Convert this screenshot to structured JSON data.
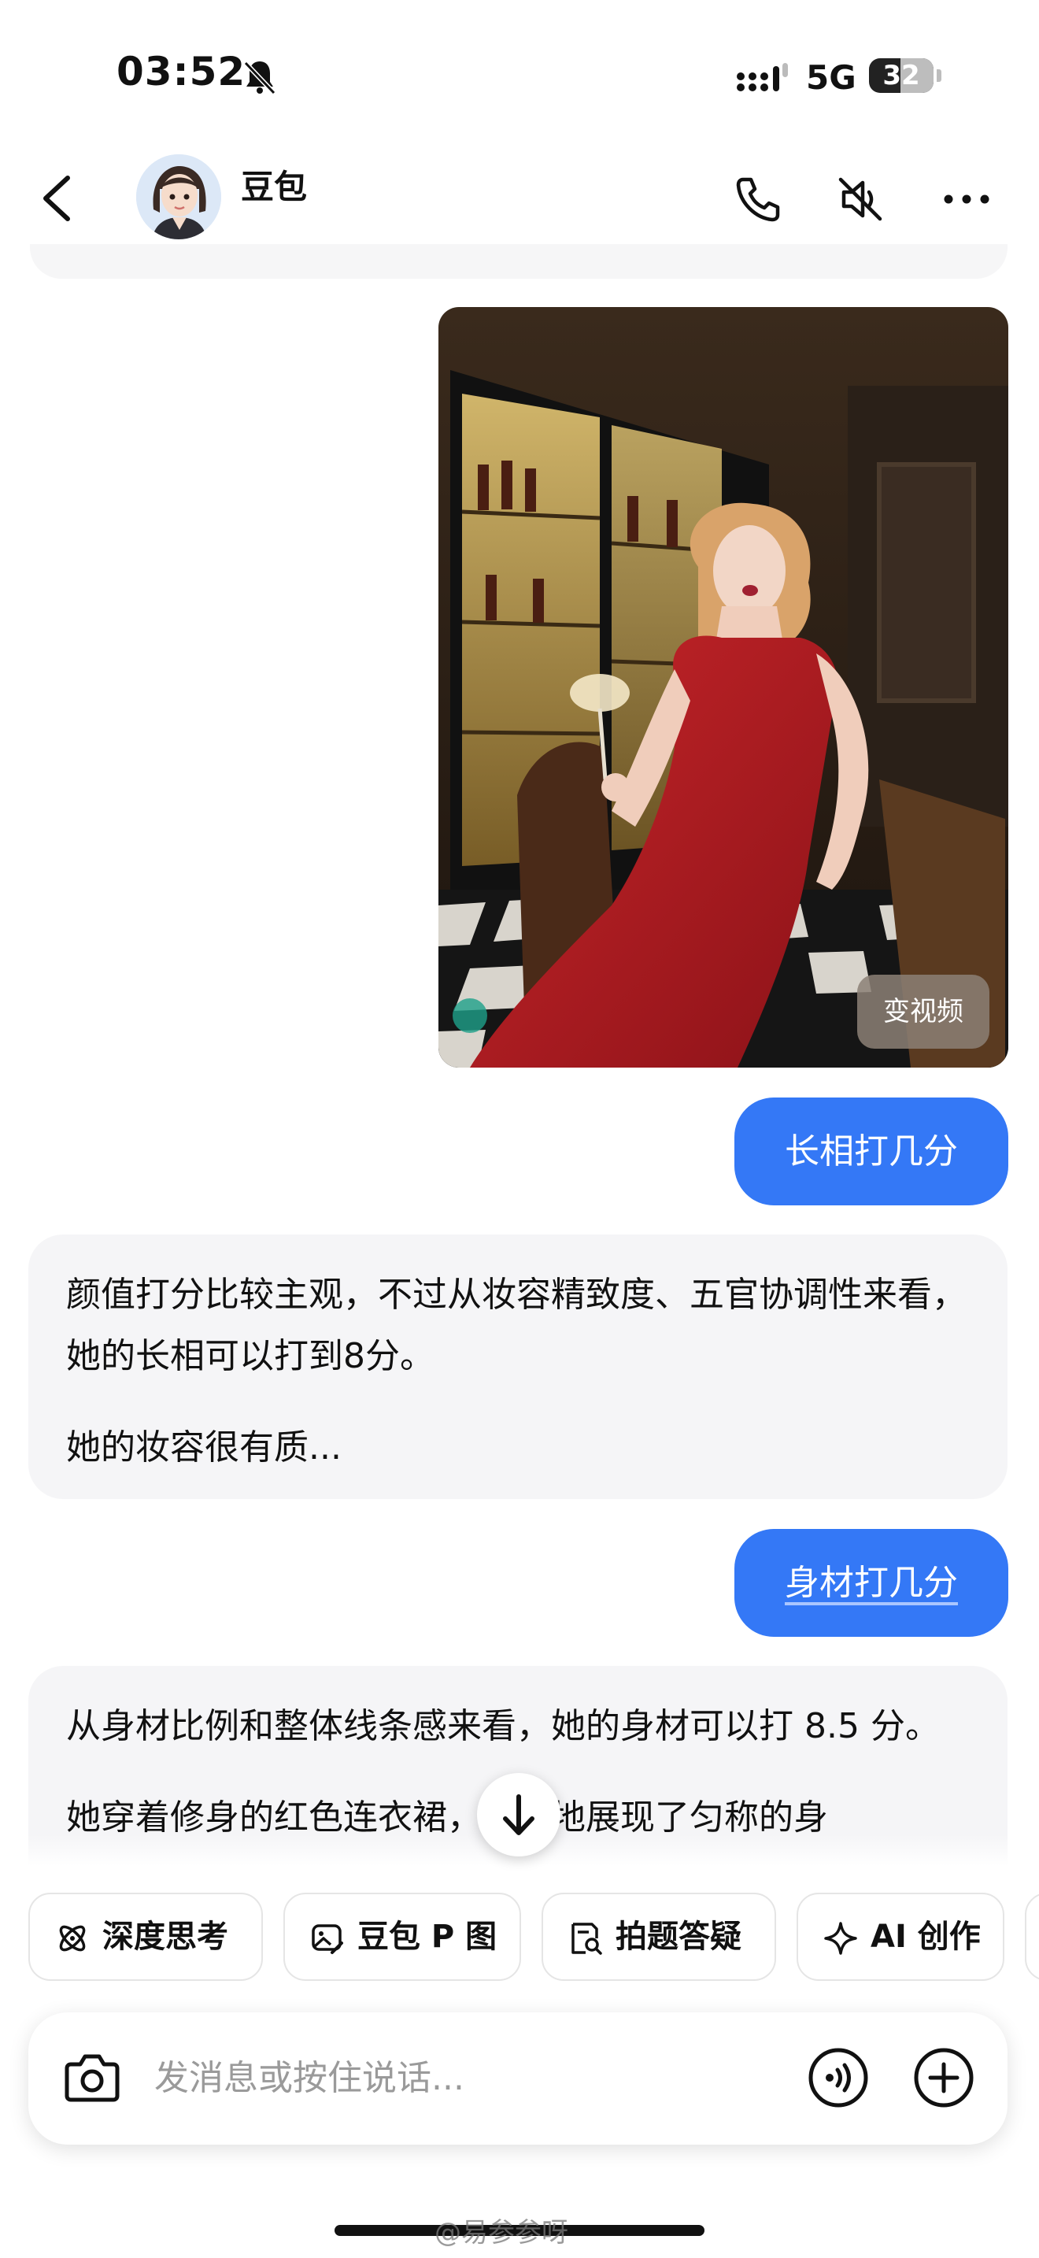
{
  "status_bar": {
    "time": "03:52",
    "network": "5G",
    "battery": "32",
    "icons": [
      "bell-muted-icon",
      "signal-icon",
      "battery-icon"
    ]
  },
  "header": {
    "back_icon": "chevron-left-icon",
    "name": "豆包",
    "icons": [
      "phone-icon",
      "speaker-muted-icon",
      "more-icon"
    ]
  },
  "chat": {
    "image_button": "变视频",
    "user_1": "长相打几分",
    "bot_1": {
      "line_1": "颜值打分比较主观，不过从妆容精致度、五官协调性来看，她的长相可以打到8分。",
      "line_2": "她的妆容很有质..."
    },
    "user_2": "身材打几分",
    "bot_2": {
      "line_1": "从身材比例和整体线条感来看，她的身材可以打 8.5 分。",
      "line_2": "她穿着修身的红色连衣裙，很好地展现了匀称的身"
    }
  },
  "chips": [
    {
      "label": "深度思考",
      "icon": "atom-icon"
    },
    {
      "label": "豆包 P 图",
      "icon": "image-edit-icon"
    },
    {
      "label": "拍题答疑",
      "icon": "doc-search-icon"
    },
    {
      "label": "AI 创作",
      "icon": "sparkle-icon"
    }
  ],
  "input": {
    "placeholder": "发消息或按住说话...",
    "icons": [
      "camera-icon",
      "voice-icon",
      "plus-icon"
    ]
  },
  "watermark": "@易参参呀",
  "colors": {
    "user_bubble": "#3478f6",
    "bot_bubble": "#f5f5f7"
  }
}
